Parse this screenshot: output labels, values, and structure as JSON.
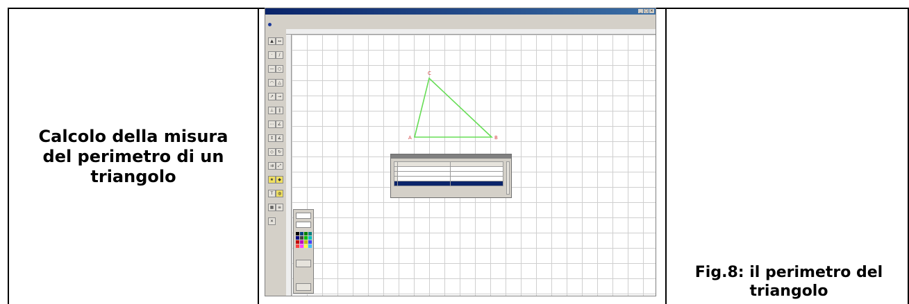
{
  "left_cell": {
    "title_lines": [
      "Calcolo della misura",
      "del perimetro di un",
      "triangolo"
    ]
  },
  "caption": {
    "lines": [
      "Fig.8: il perimetro del",
      "triangolo"
    ]
  },
  "triangle": {
    "vertex_labels": [
      "A",
      "B",
      "C"
    ]
  },
  "colors": {
    "triangle_stroke": "#66dd55",
    "vertex_label": "#d24040",
    "selection": "#0a246a"
  }
}
